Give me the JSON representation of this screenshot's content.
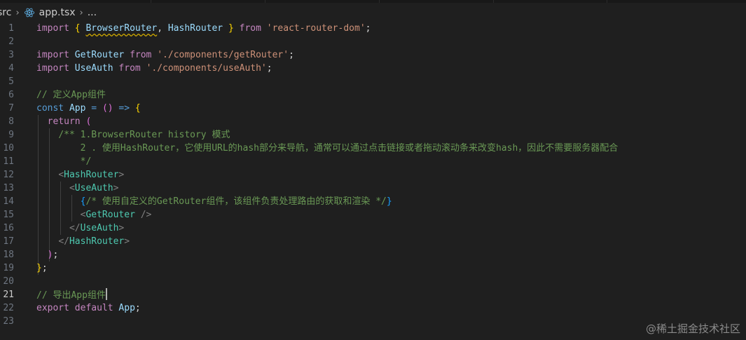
{
  "breadcrumb": {
    "folder": "src",
    "file": "app.tsx",
    "symbol": "...",
    "file_icon": "react-icon"
  },
  "code_lines": [
    {
      "n": "1",
      "text": "import { BrowserRouter, HashRouter } from 'react-router-dom';"
    },
    {
      "n": "2",
      "text": ""
    },
    {
      "n": "3",
      "text": "import GetRouter from './components/getRouter';"
    },
    {
      "n": "4",
      "text": "import UseAuth from './components/useAuth';"
    },
    {
      "n": "5",
      "text": ""
    },
    {
      "n": "6",
      "text": "// 定义App组件"
    },
    {
      "n": "7",
      "text": "const App = () => {"
    },
    {
      "n": "8",
      "text": "  return ("
    },
    {
      "n": "9",
      "text": "    /** 1.BrowserRouter history 模式"
    },
    {
      "n": "10",
      "text": "        2 . 使用HashRouter，它使用URL的hash部分来导航，通常可以通过点击链接或者拖动滚动条来改变hash，因此不需要服务器配合"
    },
    {
      "n": "11",
      "text": "        */"
    },
    {
      "n": "12",
      "text": "    <HashRouter>"
    },
    {
      "n": "13",
      "text": "      <UseAuth>"
    },
    {
      "n": "14",
      "text": "        {/* 使用自定义的GetRouter组件，该组件负责处理路由的获取和渲染 */}"
    },
    {
      "n": "15",
      "text": "        <GetRouter />"
    },
    {
      "n": "16",
      "text": "      </UseAuth>"
    },
    {
      "n": "17",
      "text": "    </HashRouter>"
    },
    {
      "n": "18",
      "text": "  );"
    },
    {
      "n": "19",
      "text": "};"
    },
    {
      "n": "20",
      "text": ""
    },
    {
      "n": "21",
      "text": "// 导出App组件"
    },
    {
      "n": "22",
      "text": "export default App;"
    },
    {
      "n": "23",
      "text": ""
    }
  ],
  "active_line": "21",
  "watermark": "@稀土掘金技术社区",
  "colors": {
    "background": "#1f1f1f",
    "keyword": "#c586c0",
    "storage": "#569cd6",
    "variable": "#9cdcfe",
    "string": "#ce9178",
    "comment": "#6a9955",
    "component_tag": "#4ec9b0",
    "bracket_gold": "#ffd700"
  }
}
